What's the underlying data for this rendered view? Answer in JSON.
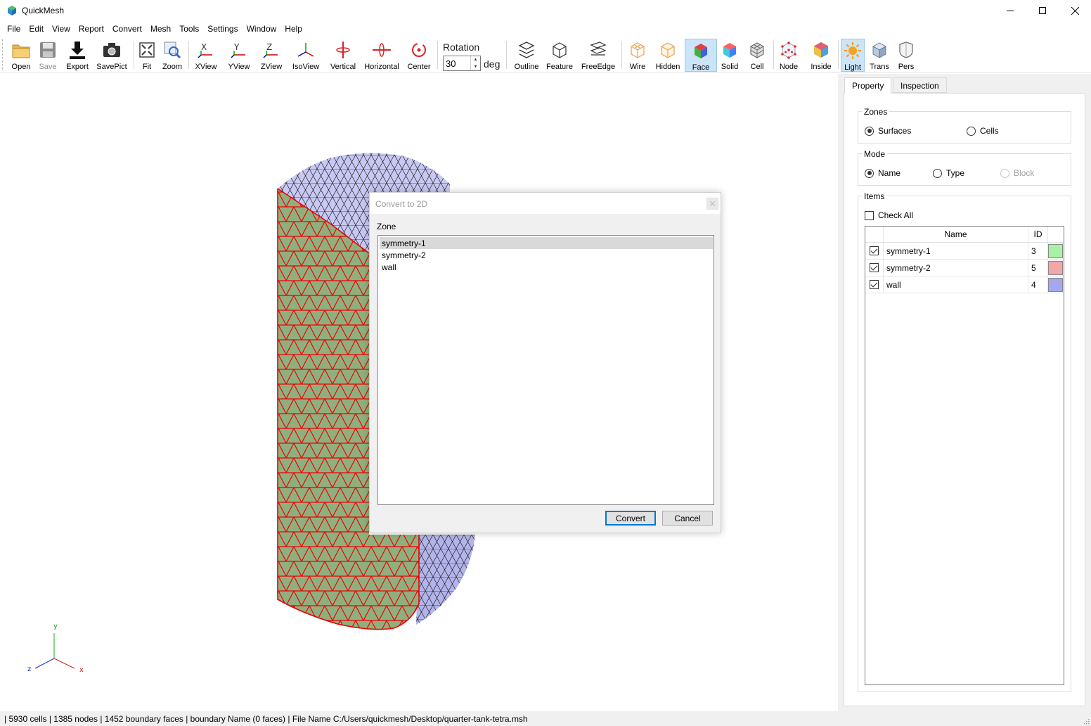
{
  "window": {
    "title": "QuickMesh",
    "controls": {
      "minimize": "minimize-icon",
      "maximize": "maximize-icon",
      "close": "close-icon"
    }
  },
  "menu": [
    "File",
    "Edit",
    "View",
    "Report",
    "Convert",
    "Mesh",
    "Tools",
    "Settings",
    "Window",
    "Help"
  ],
  "toolbar": {
    "buttons": [
      {
        "label": "Open",
        "icon": "folder-icon"
      },
      {
        "label": "Save",
        "icon": "floppy-icon",
        "disabled": true
      },
      {
        "label": "Export",
        "icon": "download-icon"
      },
      {
        "label": "SavePict",
        "icon": "camera-icon"
      },
      {
        "label": "Fit",
        "icon": "fit-icon"
      },
      {
        "label": "Zoom",
        "icon": "zoom-icon"
      },
      {
        "label": "XView",
        "icon": "x-axis-icon"
      },
      {
        "label": "YView",
        "icon": "y-axis-icon"
      },
      {
        "label": "ZView",
        "icon": "z-axis-icon"
      },
      {
        "label": "IsoView",
        "icon": "iso-axis-icon"
      },
      {
        "label": "Vertical",
        "icon": "vertical-rotate-icon"
      },
      {
        "label": "Horizontal",
        "icon": "horizontal-rotate-icon"
      },
      {
        "label": "Center",
        "icon": "center-icon"
      },
      {
        "label": "Outline",
        "icon": "outline-icon"
      },
      {
        "label": "Feature",
        "icon": "feature-icon"
      },
      {
        "label": "FreeEdge",
        "icon": "free-edge-icon"
      },
      {
        "label": "Wire",
        "icon": "wire-icon"
      },
      {
        "label": "Hidden",
        "icon": "hidden-icon"
      },
      {
        "label": "Face",
        "icon": "face-icon",
        "active": true
      },
      {
        "label": "Solid",
        "icon": "solid-icon"
      },
      {
        "label": "Cell",
        "icon": "cell-icon"
      },
      {
        "label": "Node",
        "icon": "node-icon"
      },
      {
        "label": "Inside",
        "icon": "inside-icon"
      },
      {
        "label": "Light",
        "icon": "light-icon",
        "active": true
      },
      {
        "label": "Trans",
        "icon": "trans-icon"
      },
      {
        "label": "Pers",
        "icon": "pers-icon"
      }
    ],
    "rotation": {
      "label": "Rotation",
      "value": "30",
      "unit": "deg"
    }
  },
  "viewport": {
    "axes": {
      "y": "y",
      "z": "z",
      "x": "x"
    }
  },
  "panel": {
    "tabs": [
      "Property",
      "Inspection"
    ],
    "active_tab": "Property",
    "zones": {
      "title": "Zones",
      "options": [
        "Surfaces",
        "Cells"
      ],
      "selected": "Surfaces"
    },
    "mode": {
      "title": "Mode",
      "options": [
        "Name",
        "Type",
        "Block"
      ],
      "selected": "Name",
      "disabled": [
        "Block"
      ]
    },
    "items": {
      "title": "Items",
      "check_all": "Check All",
      "columns": [
        "Name",
        "ID"
      ],
      "rows": [
        {
          "name": "symmetry-1",
          "id": "3",
          "checked": true,
          "color": "#a6f2a6"
        },
        {
          "name": "symmetry-2",
          "id": "5",
          "checked": true,
          "color": "#f2a6a6"
        },
        {
          "name": "wall",
          "id": "4",
          "checked": true,
          "color": "#a6a6f2"
        }
      ]
    }
  },
  "dialog": {
    "title": "Convert to 2D",
    "zone_label": "Zone",
    "zones": [
      "symmetry-1",
      "symmetry-2",
      "wall"
    ],
    "selected": "symmetry-1",
    "buttons": {
      "convert": "Convert",
      "cancel": "Cancel"
    }
  },
  "status": {
    "text": "| 5930 cells | 1385 nodes | 1452 boundary faces |  boundary Name  (0 faces) | File Name C:/Users/quickmesh/Desktop/quarter-tank-tetra.msh"
  }
}
